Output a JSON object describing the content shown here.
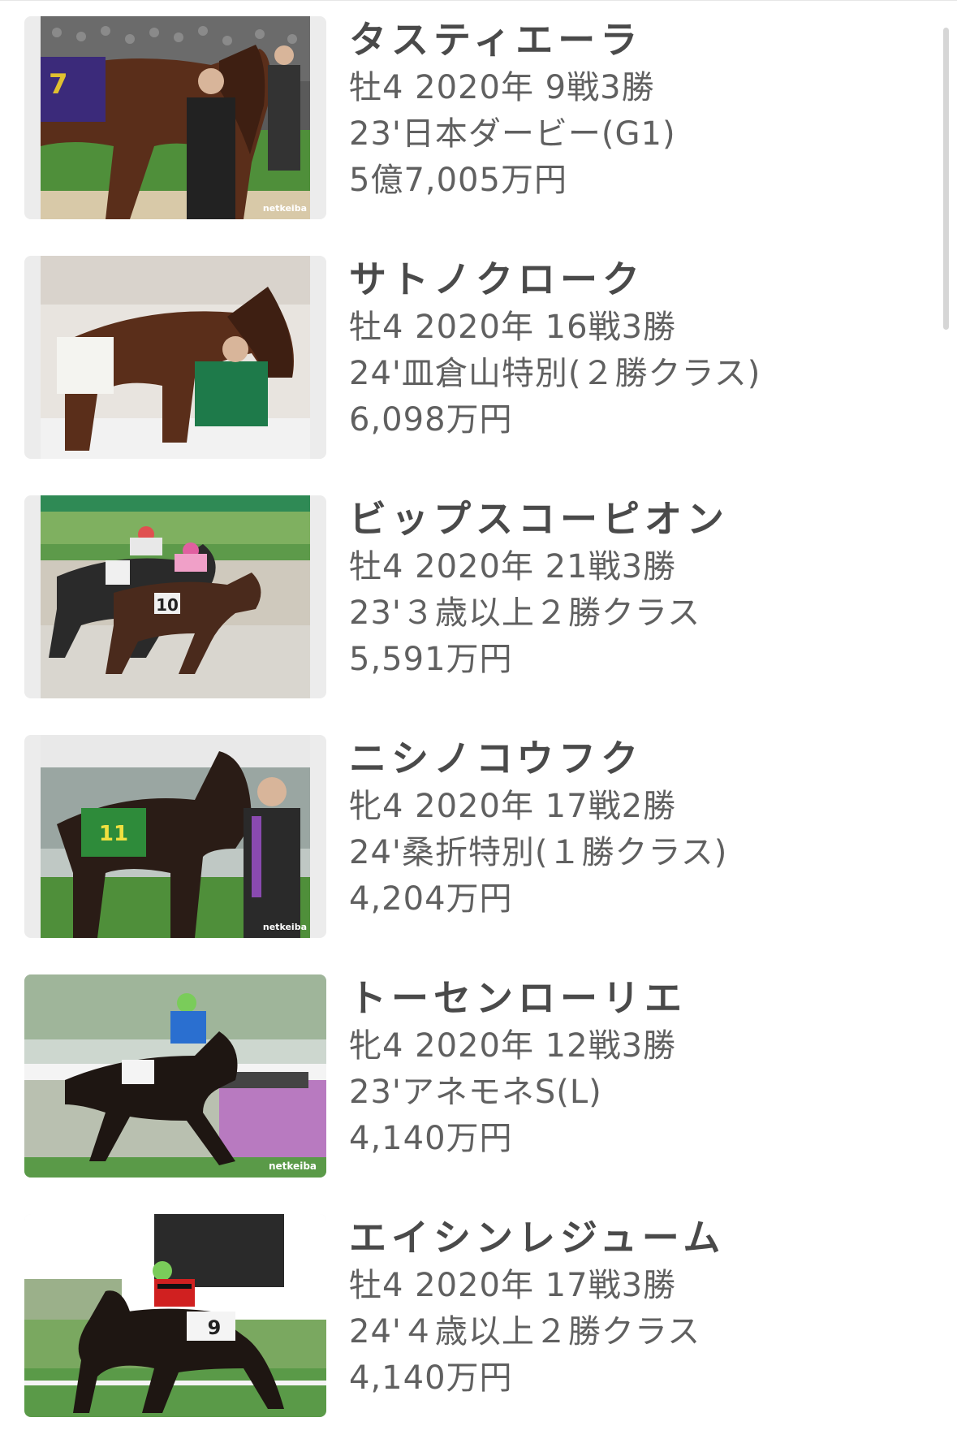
{
  "horses": [
    {
      "name": "タスティエーラ",
      "meta": "牡4 2020年 9戦3勝",
      "race": "23'日本ダービー(G1)",
      "prize": "5億7,005万円",
      "photo_icon": "horse-photo",
      "watermark": "netkeiba",
      "saddle": "7"
    },
    {
      "name": "サトノクローク",
      "meta": "牡4 2020年 16戦3勝",
      "race": "24'皿倉山特別(２勝クラス)",
      "prize": "6,098万円",
      "photo_icon": "horse-photo",
      "watermark": "",
      "saddle": ""
    },
    {
      "name": "ビップスコーピオン",
      "meta": "牡4 2020年 21戦3勝",
      "race": "23'３歳以上２勝クラス",
      "prize": "5,591万円",
      "photo_icon": "horse-photo",
      "watermark": "",
      "saddle": "10"
    },
    {
      "name": "ニシノコウフク",
      "meta": "牝4 2020年 17戦2勝",
      "race": "24'桑折特別(１勝クラス)",
      "prize": "4,204万円",
      "photo_icon": "horse-photo",
      "watermark": "netkeiba",
      "saddle": "11"
    },
    {
      "name": "トーセンローリエ",
      "meta": "牝4 2020年 12戦3勝",
      "race": "23'アネモネS(L)",
      "prize": "4,140万円",
      "photo_icon": "horse-photo",
      "watermark": "netkeiba",
      "saddle": ""
    },
    {
      "name": "エイシンレジューム",
      "meta": "牡4 2020年 17戦3勝",
      "race": "24'４歳以上２勝クラス",
      "prize": "4,140万円",
      "photo_icon": "horse-photo",
      "watermark": "",
      "saddle": "9"
    }
  ],
  "colors": {
    "turf": "#4f8f3a",
    "sky": "#bcd0d8",
    "horse_bay": "#5a2e1a",
    "horse_dark": "#2a1c16",
    "dirt": "#cfc9bd",
    "text": "#606060",
    "title": "#4a4a4a"
  }
}
